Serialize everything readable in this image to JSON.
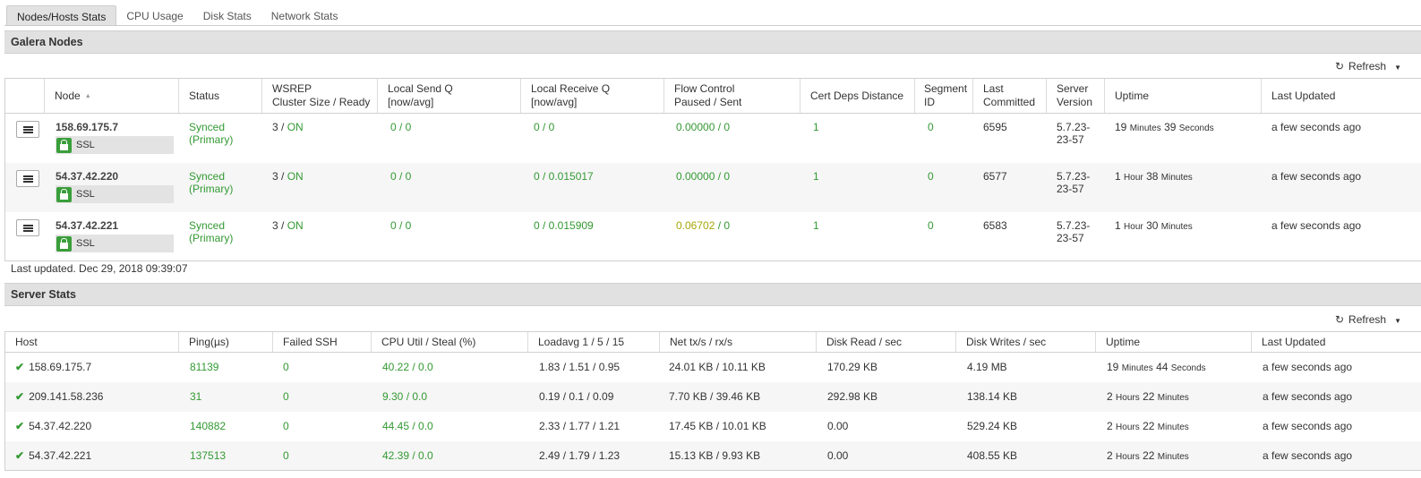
{
  "tabs": [
    {
      "label": "Nodes/Hosts Stats"
    },
    {
      "label": "CPU Usage"
    },
    {
      "label": "Disk Stats"
    },
    {
      "label": "Network Stats"
    }
  ],
  "galera": {
    "title": "Galera Nodes",
    "refresh_label": "Refresh",
    "columns": {
      "node": "Node",
      "status": "Status",
      "wsrep_1": "WSREP",
      "wsrep_2": "Cluster Size / Ready",
      "send_q_1": "Local Send Q",
      "send_q_2": "[now/avg]",
      "recv_q_1": "Local Receive Q",
      "recv_q_2": "[now/avg]",
      "flow_1": "Flow Control",
      "flow_2": "Paused / Sent",
      "cert": "Cert Deps Distance",
      "segment_1": "Segment",
      "segment_2": "ID",
      "committed_1": "Last",
      "committed_2": "Committed",
      "version_1": "Server",
      "version_2": "Version",
      "uptime": "Uptime",
      "updated": "Last Updated"
    },
    "rows": [
      {
        "node": "158.69.175.7",
        "ssl": "SSL",
        "status_1": "Synced",
        "status_2": "(Primary)",
        "cluster": "3",
        "ready": "ON",
        "send_q": "0 / 0",
        "recv_q": "0 / 0",
        "flow_paused": "0.00000",
        "flow_sent": "0",
        "cert": "1",
        "segment": "0",
        "committed": "6595",
        "version_1": "5.7.23-",
        "version_2": "23-57",
        "up_n1": "19",
        "up_u1": "Minutes",
        "up_n2": "39",
        "up_u2": "Seconds",
        "updated": "a few seconds ago"
      },
      {
        "node": "54.37.42.220",
        "ssl": "SSL",
        "status_1": "Synced",
        "status_2": "(Primary)",
        "cluster": "3",
        "ready": "ON",
        "send_q": "0 / 0",
        "recv_q": "0 / 0.015017",
        "flow_paused": "0.00000",
        "flow_sent": "0",
        "cert": "1",
        "segment": "0",
        "committed": "6577",
        "version_1": "5.7.23-",
        "version_2": "23-57",
        "up_n1": "1",
        "up_u1": "Hour",
        "up_n2": "38",
        "up_u2": "Minutes",
        "updated": "a few seconds ago"
      },
      {
        "node": "54.37.42.221",
        "ssl": "SSL",
        "status_1": "Synced",
        "status_2": "(Primary)",
        "cluster": "3",
        "ready": "ON",
        "send_q": "0 / 0",
        "recv_q": "0 / 0.015909",
        "flow_paused": "0.06702",
        "flow_sent": "0",
        "cert": "1",
        "segment": "0",
        "committed": "6583",
        "version_1": "5.7.23-",
        "version_2": "23-57",
        "up_n1": "1",
        "up_u1": "Hour",
        "up_n2": "30",
        "up_u2": "Minutes",
        "updated": "a few seconds ago"
      }
    ],
    "last_updated": "Last updated. Dec 29, 2018 09:39:07"
  },
  "server": {
    "title": "Server Stats",
    "refresh_label": "Refresh",
    "columns": {
      "host": "Host",
      "ping": "Ping(µs)",
      "failed_ssh": "Failed SSH",
      "cpu": "CPU Util / Steal (%)",
      "loadavg": "Loadavg 1 / 5 / 15",
      "net": "Net tx/s / rx/s",
      "disk_read": "Disk Read / sec",
      "disk_write": "Disk Writes / sec",
      "uptime": "Uptime",
      "updated": "Last Updated"
    },
    "rows": [
      {
        "host": "158.69.175.7",
        "ping": "81139",
        "failed_ssh": "0",
        "cpu": "40.22 / 0.0",
        "loadavg": "1.83 / 1.51 / 0.95",
        "net": "24.01 KB / 10.11 KB",
        "disk_read": "170.29 KB",
        "disk_write": "4.19 MB",
        "up_n1": "19",
        "up_u1": "Minutes",
        "up_n2": "44",
        "up_u2": "Seconds",
        "updated": "a few seconds ago"
      },
      {
        "host": "209.141.58.236",
        "ping": "31",
        "failed_ssh": "0",
        "cpu": "9.30 / 0.0",
        "loadavg": "0.19 / 0.1 / 0.09",
        "net": "7.70 KB / 39.46 KB",
        "disk_read": "292.98 KB",
        "disk_write": "138.14 KB",
        "up_n1": "2",
        "up_u1": "Hours",
        "up_n2": "22",
        "up_u2": "Minutes",
        "updated": "a few seconds ago"
      },
      {
        "host": "54.37.42.220",
        "ping": "140882",
        "failed_ssh": "0",
        "cpu": "44.45 / 0.0",
        "loadavg": "2.33 / 1.77 / 1.21",
        "net": "17.45 KB / 10.01 KB",
        "disk_read": "0.00",
        "disk_write": "529.24 KB",
        "up_n1": "2",
        "up_u1": "Hours",
        "up_n2": "22",
        "up_u2": "Minutes",
        "updated": "a few seconds ago"
      },
      {
        "host": "54.37.42.221",
        "ping": "137513",
        "failed_ssh": "0",
        "cpu": "42.39 / 0.0",
        "loadavg": "2.49 / 1.79 / 1.23",
        "net": "15.13 KB / 9.93 KB",
        "disk_read": "0.00",
        "disk_write": "408.55 KB",
        "up_n1": "2",
        "up_u1": "Hours",
        "up_n2": "22",
        "up_u2": "Minutes",
        "updated": "a few seconds ago"
      }
    ]
  },
  "colors": {
    "ok_green": "#339933",
    "warn_olive": "#a6a60a",
    "panel_header_bg": "#e1e1e1"
  }
}
